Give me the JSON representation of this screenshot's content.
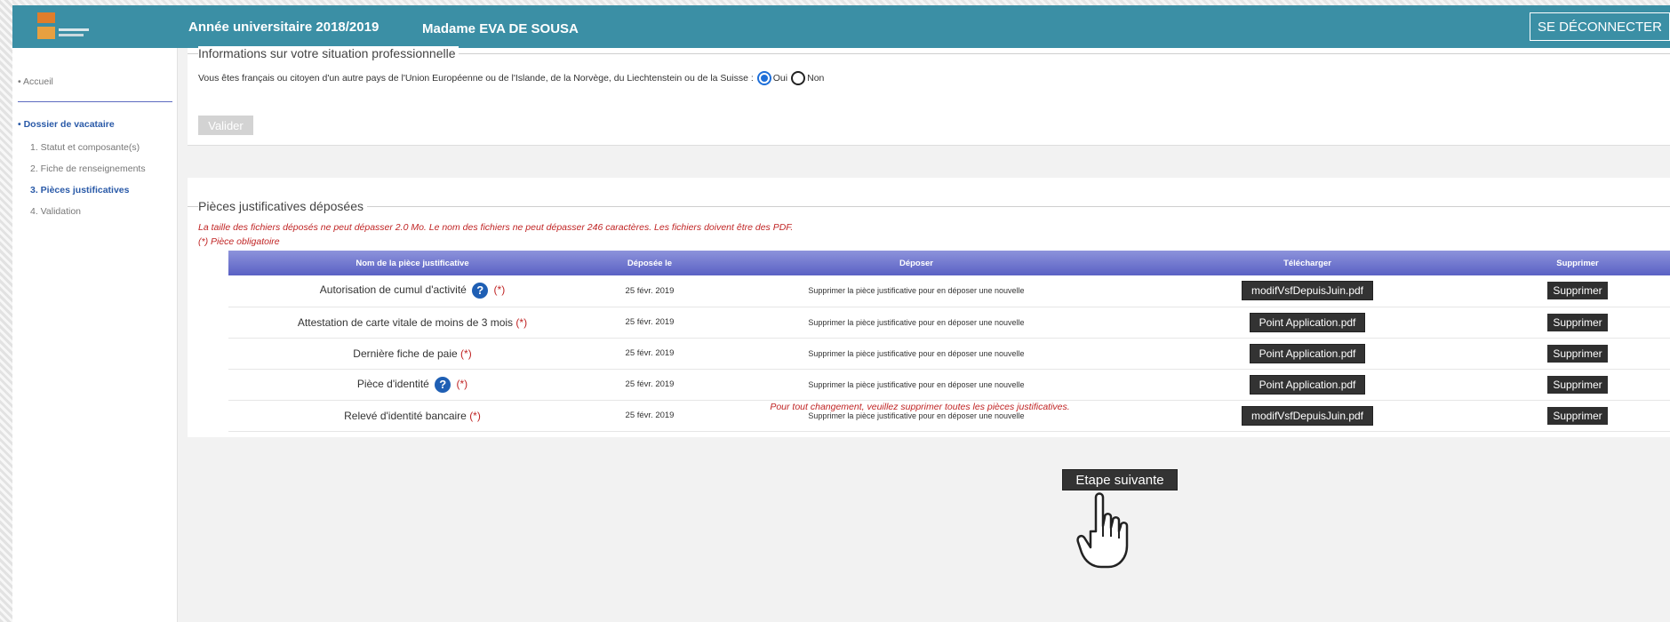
{
  "header": {
    "year_label": "Année universitaire 2018/2019",
    "user_label": "Madame EVA DE SOUSA",
    "logout_label": "SE DÉCONNECTER"
  },
  "sidebar": {
    "home": "• Accueil",
    "section": "• Dossier de vacataire",
    "steps": [
      {
        "label": "1. Statut et composante(s)"
      },
      {
        "label": "2. Fiche de renseignements"
      },
      {
        "label": "3. Pièces justificatives"
      },
      {
        "label": "4. Validation"
      }
    ]
  },
  "situation": {
    "legend": "Informations sur votre situation professionnelle",
    "question": "Vous êtes français ou citoyen d'un autre pays de l'Union Européenne ou de l'Islande, de la Norvège, du Liechtenstein ou de la Suisse :",
    "option_yes": "Oui",
    "option_no": "Non",
    "selected": "Oui",
    "validate_label": "Valider"
  },
  "documents": {
    "legend": "Pièces justificatives déposées",
    "size_warning": "La taille des fichiers déposés ne peut dépasser 2.0 Mo. Le nom des fichiers ne peut dépasser 246 caractères. Les fichiers doivent être des PDF.",
    "mandatory_note": "(*) Pièce obligatoire",
    "columns": [
      "Nom de la pièce justificative",
      "Déposée le",
      "Déposer",
      "Télécharger",
      "Supprimer"
    ],
    "rows": [
      {
        "name": "Autorisation de cumul d'activité",
        "help": true,
        "required": "(*)",
        "date": "25 févr. 2019",
        "deposit": "Supprimer la pièce justificative pour en déposer une nouvelle",
        "file": "modifVsfDepuisJuin.pdf",
        "delete": "Supprimer"
      },
      {
        "name": "Attestation de carte vitale de moins de 3 mois",
        "help": false,
        "required": "(*)",
        "date": "25 févr. 2019",
        "deposit": "Supprimer la pièce justificative pour en déposer une nouvelle",
        "file": "Point Application.pdf",
        "delete": "Supprimer"
      },
      {
        "name": "Dernière fiche de paie",
        "help": false,
        "required": "(*)",
        "date": "25 févr. 2019",
        "deposit": "Supprimer la pièce justificative pour en déposer une nouvelle",
        "file": "Point Application.pdf",
        "delete": "Supprimer"
      },
      {
        "name": "Pièce d'identité",
        "help": true,
        "required": "(*)",
        "date": "25 févr. 2019",
        "deposit": "Supprimer la pièce justificative pour en déposer une nouvelle",
        "file": "Point Application.pdf",
        "delete": "Supprimer"
      },
      {
        "name": "Relevé d'identité bancaire",
        "help": false,
        "required": "(*)",
        "date": "25 févr. 2019",
        "deposit": "Supprimer la pièce justificative pour en déposer une nouvelle",
        "file": "modifVsfDepuisJuin.pdf",
        "delete": "Supprimer"
      }
    ],
    "change_note": "Pour tout changement, veuillez supprimer toutes les pièces justificatives."
  },
  "next_label": "Etape suivante",
  "icons": {
    "help": "help-circle-icon",
    "cursor": "hand-pointer-icon"
  },
  "colors": {
    "header": "#3b8fa5",
    "table_header": "#6b72cf",
    "warning": "#c02424",
    "link": "#2a5aa8"
  }
}
